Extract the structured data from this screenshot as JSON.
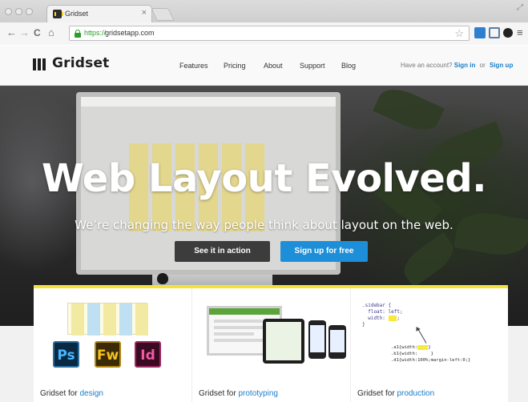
{
  "browser": {
    "tab_title": "Gridset",
    "tab_close": "×",
    "url_scheme": "https://",
    "url_host": "gridsetapp.com",
    "back_glyph": "←",
    "forward_glyph": "→",
    "reload_glyph": "C",
    "home_glyph": "⌂",
    "star_glyph": "☆",
    "menu_glyph": "≡"
  },
  "site": {
    "logo_text": "Gridset",
    "nav": [
      "Features",
      "Pricing",
      "About",
      "Support",
      "Blog"
    ],
    "account_prompt": "Have an account?",
    "sign_in": "Sign in",
    "or": "or",
    "sign_up": "Sign up"
  },
  "hero": {
    "title": "Web Layout Evolved.",
    "subtitle": "We’re changing the way people think about layout on the web.",
    "cta_secondary": "See it in action",
    "cta_primary": "Sign up for free"
  },
  "features": [
    {
      "prefix": "Gridset for ",
      "highlight": "design"
    },
    {
      "prefix": "Gridset for ",
      "highlight": "prototyping"
    },
    {
      "prefix": "Gridset for ",
      "highlight": "production"
    }
  ],
  "design_icons": [
    "Ps",
    "Fw",
    "Id"
  ],
  "colors": {
    "accent_blue": "#1d8fd8",
    "accent_yellow": "#f3e23a",
    "dark_button": "#3c3c3c"
  }
}
